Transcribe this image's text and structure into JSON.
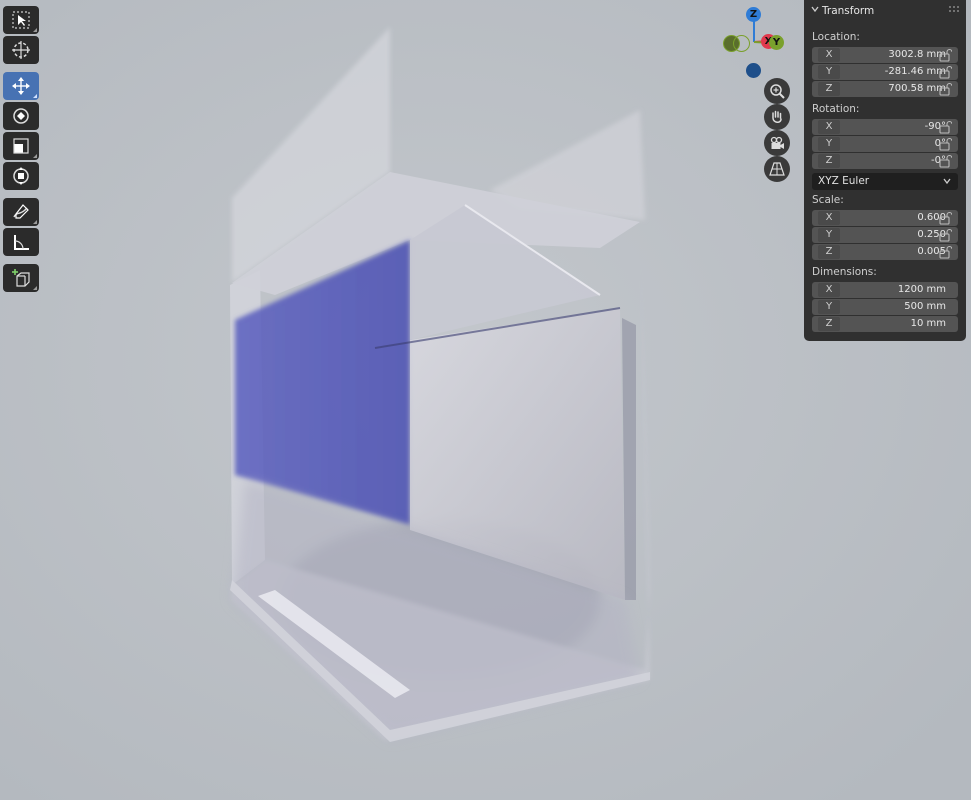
{
  "transform_panel": {
    "title": "Transform",
    "location": {
      "label": "Location:",
      "rows": [
        {
          "axis": "X",
          "value": "3002.8 mm"
        },
        {
          "axis": "Y",
          "value": "-281.46 mm"
        },
        {
          "axis": "Z",
          "value": "700.58 mm"
        }
      ]
    },
    "rotation": {
      "label": "Rotation:",
      "rows": [
        {
          "axis": "X",
          "value": "-90°"
        },
        {
          "axis": "Y",
          "value": "0°"
        },
        {
          "axis": "Z",
          "value": "-0°"
        }
      ],
      "mode": "XYZ Euler"
    },
    "scale": {
      "label": "Scale:",
      "rows": [
        {
          "axis": "X",
          "value": "0.600"
        },
        {
          "axis": "Y",
          "value": "0.250"
        },
        {
          "axis": "Z",
          "value": "0.005"
        }
      ]
    },
    "dimensions": {
      "label": "Dimensions:",
      "rows": [
        {
          "axis": "X",
          "value": "1200 mm"
        },
        {
          "axis": "Y",
          "value": "500 mm"
        },
        {
          "axis": "Z",
          "value": "10 mm"
        }
      ]
    }
  },
  "gizmo": {
    "z_label": "Z",
    "x_label": "X",
    "y_label": "Y",
    "colors": {
      "x": "#e0394d",
      "y": "#7aa02c",
      "z": "#2f7cd6"
    }
  },
  "toolbar": {
    "tools": [
      "select-box",
      "cursor",
      "move",
      "rotate",
      "scale",
      "transform",
      "annotate",
      "measure",
      "add-cube"
    ],
    "active": "move"
  },
  "colors": {
    "viewport_bg": "#b9bec4",
    "panel_bg": "#303030",
    "field_bg": "#545454",
    "accent": "#4772b3",
    "selected_face": "#5a5fc0"
  }
}
